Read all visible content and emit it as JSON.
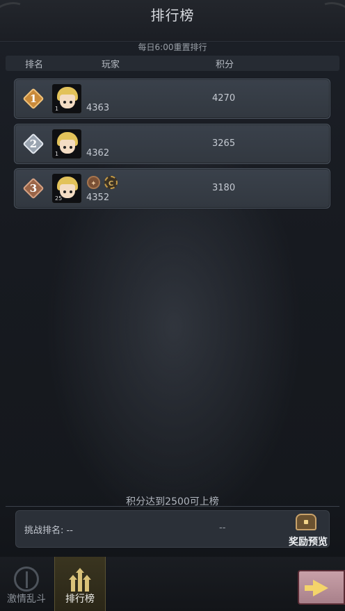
{
  "header": {
    "title": "排行榜",
    "reset_note": "每日6:00重置排行"
  },
  "table": {
    "columns": [
      "排名",
      "玩家",
      "积分"
    ]
  },
  "rows": [
    {
      "rank": "1",
      "level": "1",
      "player_id": "4363",
      "score": "4270",
      "badge_color": "#c98a3a"
    },
    {
      "rank": "2",
      "level": "1",
      "player_id": "4362",
      "score": "3265",
      "badge_color": "#9aa4b0"
    },
    {
      "rank": "3",
      "level": "25",
      "player_id": "4352",
      "score": "3180",
      "badge_color": "#9a6548",
      "medals": [
        "medal-icon",
        "c-medal-icon"
      ]
    }
  ],
  "footer": {
    "threshold_text": "积分达到2500可上榜",
    "challenge_label": "挑战排名: --",
    "challenge_value": "--",
    "reward_label": "奖励预览"
  },
  "tabs": [
    {
      "label": "激情乱斗",
      "icon": "arena-icon",
      "active": false
    },
    {
      "label": "排行榜",
      "icon": "ranking-icon",
      "active": true
    }
  ],
  "colors": {
    "accent_gold": "#d9c27a",
    "next_button": "#c8a0a8"
  }
}
